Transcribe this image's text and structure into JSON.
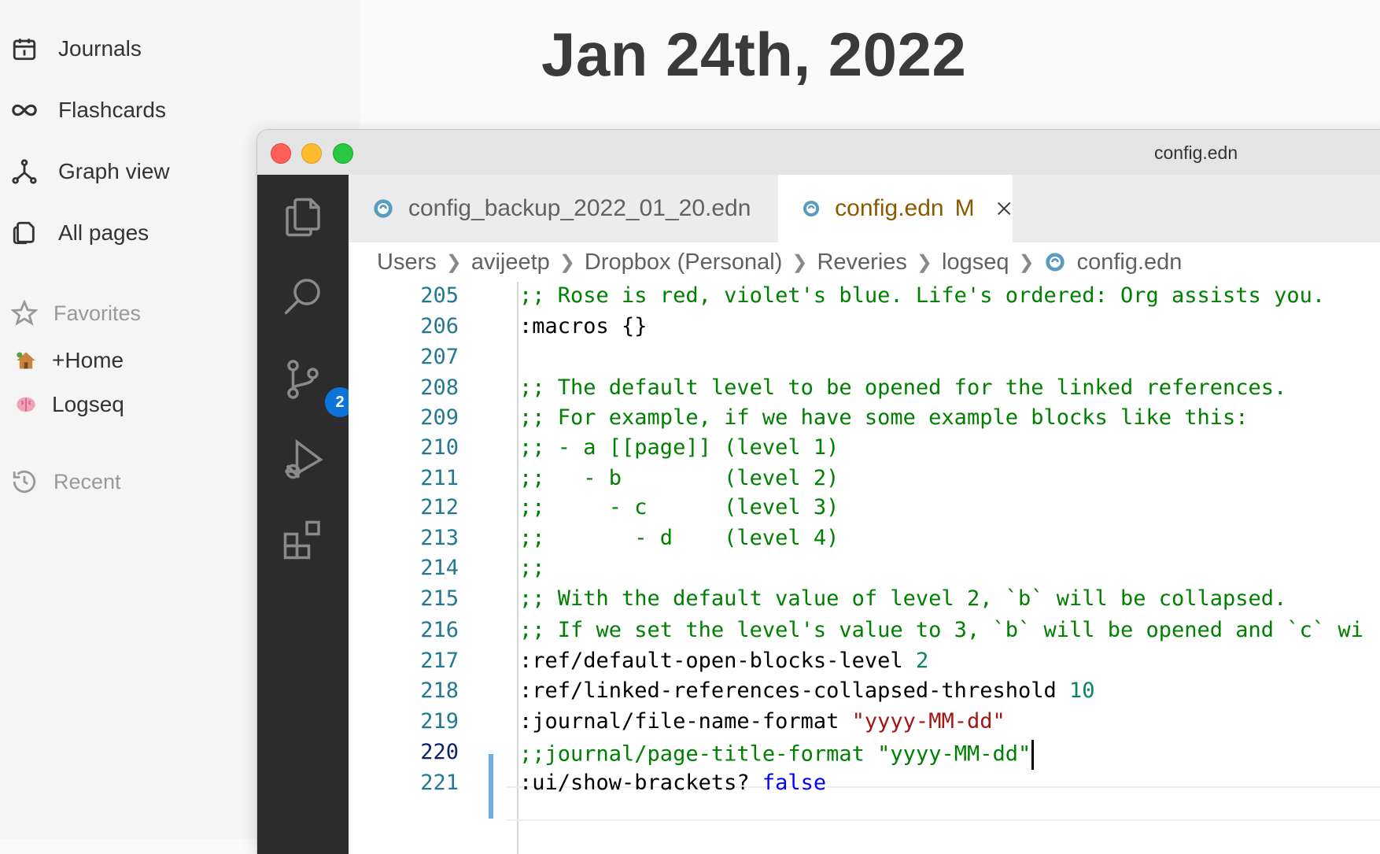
{
  "sidebar": {
    "nav": [
      {
        "label": "Journals",
        "icon": "calendar-icon"
      },
      {
        "label": "Flashcards",
        "icon": "infinity-icon"
      },
      {
        "label": "Graph view",
        "icon": "graph-icon"
      },
      {
        "label": "All pages",
        "icon": "pages-icon"
      }
    ],
    "favorites_label": "Favorites",
    "favorites": [
      {
        "label": "+Home",
        "icon": "house-emoji-icon"
      },
      {
        "label": "Logseq",
        "icon": "brain-emoji-icon"
      }
    ],
    "recent_label": "Recent"
  },
  "page": {
    "title": "Jan 24th, 2022"
  },
  "vscode": {
    "window_title": "config.edn",
    "scm_badge": "2",
    "tabs": [
      {
        "label": "config_backup_2022_01_20.edn",
        "active": false
      },
      {
        "label": "config.edn",
        "active": true,
        "modified": "M"
      }
    ],
    "breadcrumb": [
      "Users",
      "avijeetp",
      "Dropbox (Personal)",
      "Reveries",
      "logseq",
      "config.edn"
    ],
    "lines": [
      {
        "num": "205",
        "text": ";; Rose is red, violet's blue. Life's ordered: Org assists you."
      },
      {
        "num": "206",
        "text": ":macros {}"
      },
      {
        "num": "207",
        "text": ""
      },
      {
        "num": "208",
        "text": ";; The default level to be opened for the linked references."
      },
      {
        "num": "209",
        "text": ";; For example, if we have some example blocks like this:"
      },
      {
        "num": "210",
        "text": ";; - a [[page]] (level 1)"
      },
      {
        "num": "211",
        "text": ";;   - b        (level 2)"
      },
      {
        "num": "212",
        "text": ";;     - c      (level 3)"
      },
      {
        "num": "213",
        "text": ";;       - d    (level 4)"
      },
      {
        "num": "214",
        "text": ";;"
      },
      {
        "num": "215",
        "text": ";; With the default value of level 2, `b` will be collapsed."
      },
      {
        "num": "216",
        "text": ";; If we set the level's value to 3, `b` will be opened and `c` wi"
      },
      {
        "num": "217",
        "key": ":ref/default-open-blocks-level",
        "value": "2"
      },
      {
        "num": "218",
        "key": ":ref/linked-references-collapsed-threshold",
        "value": "10"
      },
      {
        "num": "219",
        "key": ":journal/file-name-format",
        "str": "\"yyyy-MM-dd\""
      },
      {
        "num": "220",
        "comment": ";;journal/page-title-format",
        "str": "\"yyyy-MM-dd\""
      },
      {
        "num": "221",
        "key": ":ui/show-brackets?",
        "kw": "false"
      }
    ]
  }
}
